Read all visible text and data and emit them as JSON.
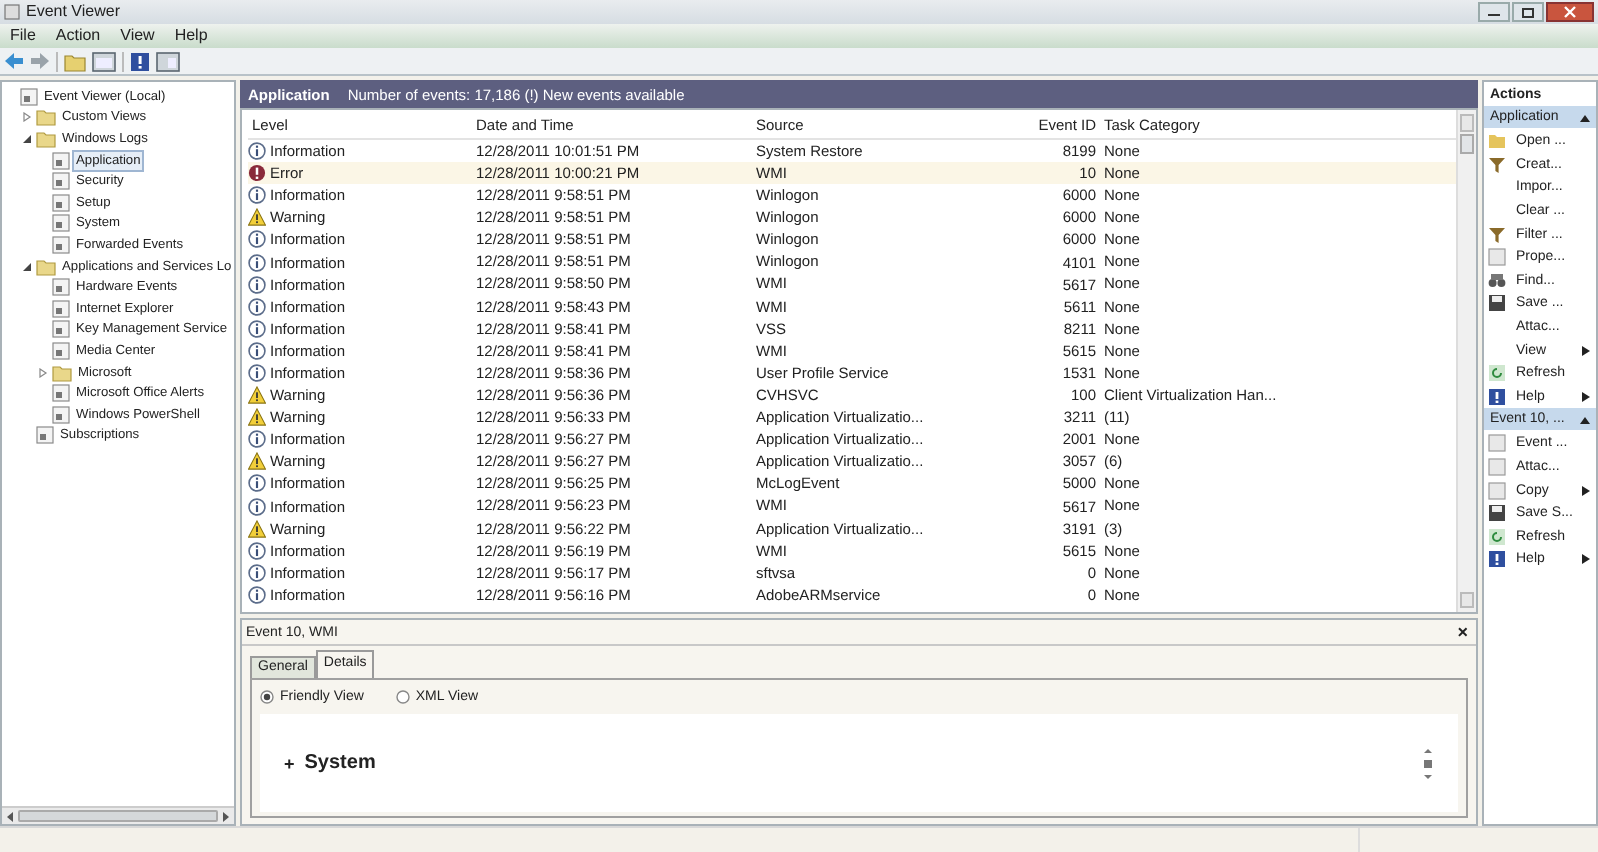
{
  "window": {
    "title": "Event Viewer"
  },
  "menu": [
    "File",
    "Action",
    "View",
    "Help"
  ],
  "tree": [
    {
      "label": "Event Viewer (Local)",
      "selected": false,
      "children": [
        {
          "label": "Custom Views",
          "selected": false,
          "expanded": false
        },
        {
          "label": "Windows Logs",
          "selected": false,
          "expanded": true,
          "children": [
            {
              "label": "Application",
              "selected": true
            },
            {
              "label": "Security",
              "selected": false
            },
            {
              "label": "Setup",
              "selected": false
            },
            {
              "label": "System",
              "selected": false
            },
            {
              "label": "Forwarded Events",
              "selected": false
            }
          ]
        },
        {
          "label": "Applications and Services Lo",
          "selected": false,
          "expanded": true,
          "children": [
            {
              "label": "Hardware Events",
              "selected": false
            },
            {
              "label": "Internet Explorer",
              "selected": false
            },
            {
              "label": "Key Management Service",
              "selected": false
            },
            {
              "label": "Media Center",
              "selected": false
            },
            {
              "label": "Microsoft",
              "selected": false,
              "expanded": false
            },
            {
              "label": "Microsoft Office Alerts",
              "selected": false
            },
            {
              "label": "Windows PowerShell",
              "selected": false
            }
          ]
        },
        {
          "label": "Subscriptions",
          "selected": false
        }
      ]
    }
  ],
  "log_header": {
    "title": "Application",
    "info": "Number of events: 17,186 (!) New events available"
  },
  "table": {
    "columns": [
      "Level",
      "Date and Time",
      "Source",
      "Event ID",
      "Task Category"
    ],
    "rows": [
      {
        "kind": "information",
        "level": "Information",
        "date": "12/28/2011 10:01:51 PM",
        "source": "System Restore",
        "event_id": "8199",
        "task": "None",
        "selected": false
      },
      {
        "kind": "error",
        "level": "Error",
        "date": "12/28/2011 10:00:21 PM",
        "source": "WMI",
        "event_id": "10",
        "task": "None",
        "selected": true
      },
      {
        "kind": "information",
        "level": "Information",
        "date": "12/28/2011 9:58:51 PM",
        "source": "Winlogon",
        "event_id": "6000",
        "task": "None",
        "selected": false
      },
      {
        "kind": "warning",
        "level": "Warning",
        "date": "12/28/2011 9:58:51 PM",
        "source": "Winlogon",
        "event_id": "6000",
        "task": "None",
        "selected": false
      },
      {
        "kind": "information",
        "level": "Information",
        "date": "12/28/2011 9:58:51 PM",
        "source": "Winlogon",
        "event_id": "6000",
        "task": "None",
        "selected": false
      },
      {
        "kind": "information",
        "level": "Information",
        "date": "12/28/2011 9:58:51 PM",
        "source": "Winlogon",
        "event_id": "4101",
        "task": "None",
        "selected": false
      },
      {
        "kind": "information",
        "level": "Information",
        "date": "12/28/2011 9:58:50 PM",
        "source": "WMI",
        "event_id": "5617",
        "task": "None",
        "selected": false
      },
      {
        "kind": "information",
        "level": "Information",
        "date": "12/28/2011 9:58:43 PM",
        "source": "WMI",
        "event_id": "5611",
        "task": "None",
        "selected": false
      },
      {
        "kind": "information",
        "level": "Information",
        "date": "12/28/2011 9:58:41 PM",
        "source": "VSS",
        "event_id": "8211",
        "task": "None",
        "selected": false
      },
      {
        "kind": "information",
        "level": "Information",
        "date": "12/28/2011 9:58:41 PM",
        "source": "WMI",
        "event_id": "5615",
        "task": "None",
        "selected": false
      },
      {
        "kind": "information",
        "level": "Information",
        "date": "12/28/2011 9:58:36 PM",
        "source": "User Profile Service",
        "event_id": "1531",
        "task": "None",
        "selected": false
      },
      {
        "kind": "warning",
        "level": "Warning",
        "date": "12/28/2011 9:56:36 PM",
        "source": "CVHSVC",
        "event_id": "100",
        "task": "Client Virtualization Han...",
        "selected": false
      },
      {
        "kind": "warning",
        "level": "Warning",
        "date": "12/28/2011 9:56:33 PM",
        "source": "Application Virtualizatio...",
        "event_id": "3211",
        "task": "(11)",
        "selected": false
      },
      {
        "kind": "information",
        "level": "Information",
        "date": "12/28/2011 9:56:27 PM",
        "source": "Application Virtualizatio...",
        "event_id": "2001",
        "task": "None",
        "selected": false
      },
      {
        "kind": "warning",
        "level": "Warning",
        "date": "12/28/2011 9:56:27 PM",
        "source": "Application Virtualizatio...",
        "event_id": "3057",
        "task": "(6)",
        "selected": false
      },
      {
        "kind": "information",
        "level": "Information",
        "date": "12/28/2011 9:56:25 PM",
        "source": "McLogEvent",
        "event_id": "5000",
        "task": "None",
        "selected": false
      },
      {
        "kind": "information",
        "level": "Information",
        "date": "12/28/2011 9:56:23 PM",
        "source": "WMI",
        "event_id": "5617",
        "task": "None",
        "selected": false
      },
      {
        "kind": "warning",
        "level": "Warning",
        "date": "12/28/2011 9:56:22 PM",
        "source": "Application Virtualizatio...",
        "event_id": "3191",
        "task": "(3)",
        "selected": false
      },
      {
        "kind": "information",
        "level": "Information",
        "date": "12/28/2011 9:56:19 PM",
        "source": "WMI",
        "event_id": "5615",
        "task": "None",
        "selected": false
      },
      {
        "kind": "information",
        "level": "Information",
        "date": "12/28/2011 9:56:17 PM",
        "source": "sftvsa",
        "event_id": "0",
        "task": "None",
        "selected": false
      },
      {
        "kind": "information",
        "level": "Information",
        "date": "12/28/2011 9:56:16 PM",
        "source": "AdobeARMservice",
        "event_id": "0",
        "task": "None",
        "selected": false
      }
    ]
  },
  "details": {
    "title": "Event 10, WMI",
    "close": "×",
    "tabs": [
      {
        "label": "General",
        "selected": false
      },
      {
        "label": "Details",
        "selected": true
      }
    ],
    "views": [
      {
        "label": "Friendly View",
        "selected": true
      },
      {
        "label": "XML View",
        "selected": false
      }
    ],
    "section": {
      "expander": "+",
      "label": "System"
    }
  },
  "actions": {
    "title": "Actions",
    "sections": [
      {
        "title": "Application",
        "items": [
          {
            "label": "Open ...",
            "submenu": false
          },
          {
            "label": "Creat...",
            "submenu": false
          },
          {
            "label": "Impor...",
            "submenu": false
          },
          {
            "label": "Clear ...",
            "submenu": false
          },
          {
            "label": "Filter ...",
            "submenu": false
          },
          {
            "label": "Prope...",
            "submenu": false
          },
          {
            "label": "Find...",
            "submenu": false
          },
          {
            "label": "Save ...",
            "submenu": false
          },
          {
            "label": "Attac...",
            "submenu": false
          },
          {
            "label": "View",
            "submenu": true
          },
          {
            "label": "Refresh",
            "submenu": false
          },
          {
            "label": "Help",
            "submenu": true
          }
        ]
      },
      {
        "title": "Event 10, ...",
        "items": [
          {
            "label": "Event ...",
            "submenu": false
          },
          {
            "label": "Attac...",
            "submenu": false
          },
          {
            "label": "Copy",
            "submenu": true
          },
          {
            "label": "Save S...",
            "submenu": false
          },
          {
            "label": "Refresh",
            "submenu": false
          },
          {
            "label": "Help",
            "submenu": true
          }
        ]
      }
    ]
  }
}
